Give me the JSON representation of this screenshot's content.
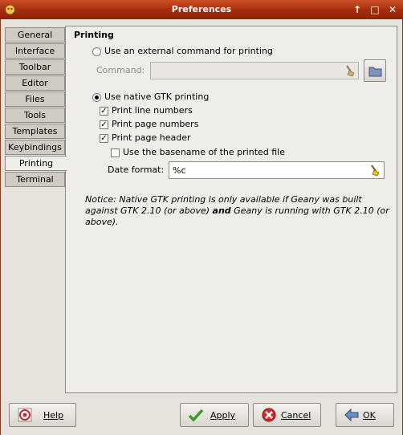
{
  "window": {
    "title": "Preferences"
  },
  "tabs": [
    {
      "label": "General"
    },
    {
      "label": "Interface"
    },
    {
      "label": "Toolbar"
    },
    {
      "label": "Editor"
    },
    {
      "label": "Files"
    },
    {
      "label": "Tools"
    },
    {
      "label": "Templates"
    },
    {
      "label": "Keybindings"
    },
    {
      "label": "Printing",
      "active": true
    },
    {
      "label": "Terminal"
    }
  ],
  "printing": {
    "heading": "Printing",
    "external_label": "Use an external command for printing",
    "external_selected": false,
    "command_label": "Command:",
    "command_value": "",
    "native_label": "Use native GTK printing",
    "native_selected": true,
    "line_numbers_label": "Print line numbers",
    "line_numbers_checked": true,
    "page_numbers_label": "Print page numbers",
    "page_numbers_checked": true,
    "page_header_label": "Print page header",
    "page_header_checked": true,
    "basename_label": "Use the basename of the printed file",
    "basename_checked": false,
    "date_format_label": "Date format:",
    "date_format_value": "%c",
    "notice_1": "Notice: Native GTK printing is only available if Geany was built against GTK 2.10 (or above) ",
    "notice_bold": "and",
    "notice_2": " Geany is running with GTK 2.10 (or above)."
  },
  "buttons": {
    "help": "Help",
    "apply": "Apply",
    "cancel": "Cancel",
    "ok": "OK"
  },
  "icons": {
    "app": "geany-icon",
    "clear": "broom-icon",
    "browse": "folder-icon",
    "help": "help-icon",
    "apply": "check-icon",
    "cancel": "cancel-icon",
    "ok": "ok-arrow-icon"
  }
}
